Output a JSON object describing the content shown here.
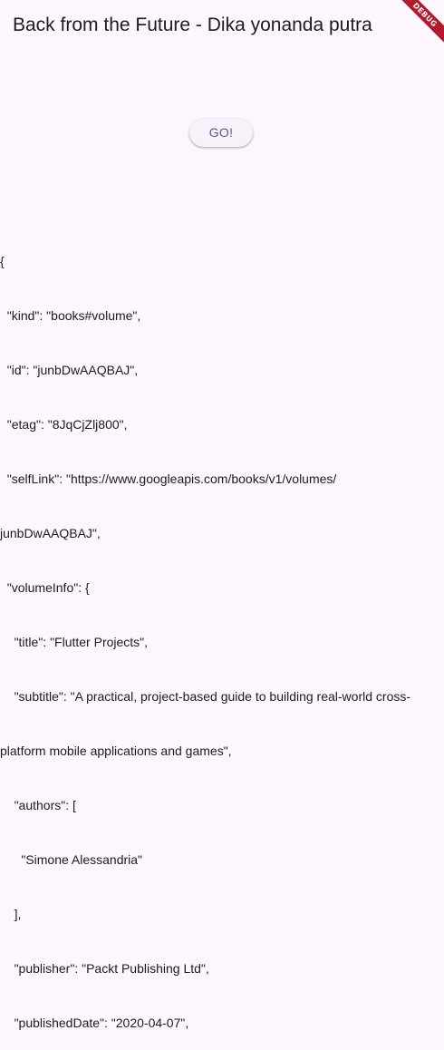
{
  "app_bar": {
    "title": "Back from the Future - Dika yonanda putra"
  },
  "debug_banner": {
    "label": "DEBUG"
  },
  "go_button": {
    "label": "GO!"
  },
  "response": {
    "lines": [
      "{",
      "  \"kind\": \"books#volume\",",
      "  \"id\": \"junbDwAAQBAJ\",",
      "  \"etag\": \"8JqCjZlj800\",",
      "  \"selfLink\": \"https://www.googleapis.com/books/v1/volumes/",
      "junbDwAAQBAJ\",",
      "  \"volumeInfo\": {",
      "    \"title\": \"Flutter Projects\",",
      "    \"subtitle\": \"A practical, project-based guide to building real-world cross-",
      "platform mobile applications and games\",",
      "    \"authors\": [",
      "      \"Simone Alessandria\"",
      "    ],",
      "    \"publisher\": \"Packt Publishing Ltd\",",
      "    \"publishedDate\": \"2020-04-07\","
    ]
  },
  "colors": {
    "background": "#fdf7fd",
    "button_text": "#65558f",
    "debug_banner": "#b11b2e"
  }
}
